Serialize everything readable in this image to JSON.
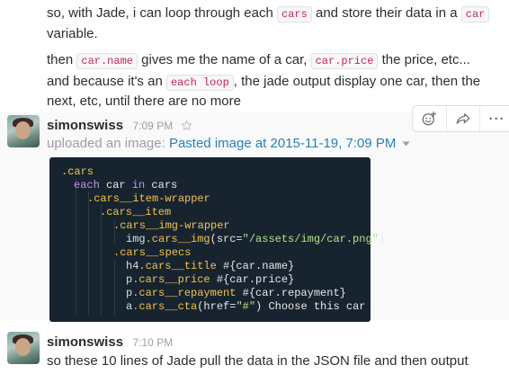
{
  "top_message": {
    "line1_a": "so, with Jade, i can loop through each",
    "line1_code1": "cars",
    "line1_b": "and store their data in a",
    "line1_code2": "car",
    "line2": "variable.",
    "line3_a": "then",
    "line3_code1": "car.name",
    "line3_b": "gives me the name of a car,",
    "line3_code2": "car.price",
    "line3_c": "the price, etc...",
    "line4_a": "and because it's an",
    "line4_code": "each loop",
    "line4_b": ", the jade output display one car, then the",
    "line5": "next, etc, until there are no more"
  },
  "message_one": {
    "username": "simonswiss",
    "time": "7:09 PM",
    "uploaded_prefix": "uploaded an image:",
    "file_link": "Pasted image at 2015-11-19, 7:09 PM",
    "actions": {
      "emoji_icon": "add-reaction-icon",
      "share_icon": "share-arrow-icon",
      "more_icon": "more-horizontal-icon",
      "more_glyph": "···"
    },
    "code_lines": [
      [
        ".cars"
      ],
      [
        "each",
        " car ",
        "in",
        " cars"
      ],
      [
        ".cars__item-wrapper"
      ],
      [
        ".cars__item"
      ],
      [
        ".cars__img-wrapper"
      ],
      [
        "img",
        ".cars__img",
        "(src=",
        "\"/assets/img/car.png\"",
        ")"
      ],
      [
        ".cars__specs"
      ],
      [
        "h4",
        ".cars__title ",
        "#{car.name}"
      ],
      [
        "p",
        ".cars__price ",
        "#{car.price}"
      ],
      [
        "p",
        ".cars__repayment ",
        "#{car.repayment}"
      ],
      [
        "a",
        ".cars__cta",
        "(href=",
        "\"#\"",
        ") Choose this car"
      ]
    ]
  },
  "message_two": {
    "username": "simonswiss",
    "time": "7:10 PM",
    "text": "so these 10 lines of Jade pull the data in the JSON file and then output"
  },
  "colors": {
    "link": "#2a80b9",
    "code_bg": "#172430",
    "selector": "#f3c34c",
    "keyword": "#c792ea",
    "string": "#b5e28a"
  }
}
